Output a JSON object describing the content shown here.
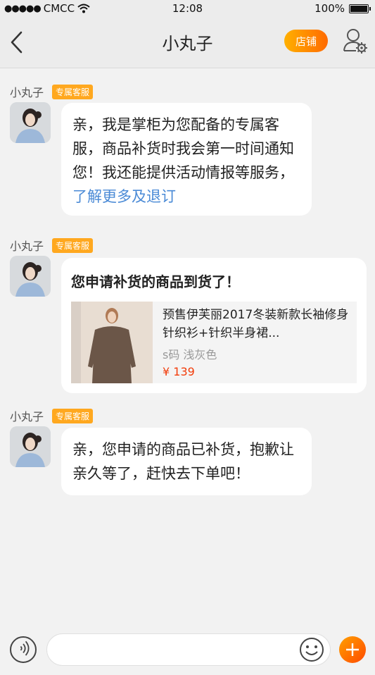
{
  "status_bar": {
    "carrier": "CMCC",
    "time": "12:08",
    "battery": "100%"
  },
  "nav": {
    "title": "小丸子",
    "shop_label": "店铺"
  },
  "messages": [
    {
      "sender": "小丸子",
      "tag": "专属客服",
      "text": "亲，我是掌柜为您配备的专属客服，商品补货时我会第一时间通知您！我还能提供活动情报等服务，",
      "link": "了解更多及退订"
    },
    {
      "sender": "小丸子",
      "tag": "专属客服",
      "card_title": "您申请补货的商品到货了！",
      "product": {
        "name": "预售伊芙丽2017冬装新款长袖修身针织衫+针织半身裙...",
        "spec": "s码 浅灰色",
        "price": "¥ 139"
      }
    },
    {
      "sender": "小丸子",
      "tag": "专属客服",
      "text": "亲，您申请的商品已补货，抱歉让亲久等了，赶快去下单吧！"
    }
  ],
  "input_bar": {
    "placeholder": ""
  },
  "icons": {
    "back": "back-arrow-icon",
    "user_settings": "user-settings-icon",
    "voice": "voice-icon",
    "emoji": "emoji-icon",
    "plus": "plus-icon"
  },
  "colors": {
    "accent": "#ff8a00",
    "tag": "#ffa81f",
    "link": "#4a8ad6",
    "price": "#f23c0a"
  }
}
